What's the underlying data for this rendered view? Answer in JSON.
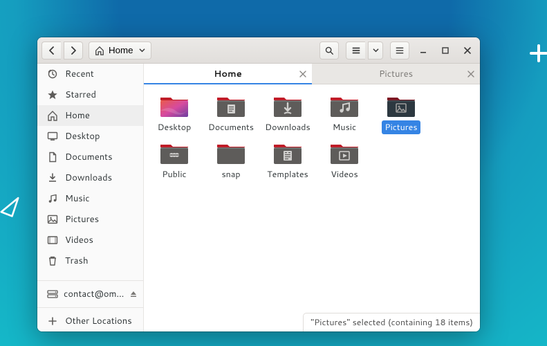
{
  "header": {
    "path_label": "Home"
  },
  "sidebar": {
    "items": [
      {
        "key": "recent",
        "label": "Recent",
        "icon": "clock"
      },
      {
        "key": "starred",
        "label": "Starred",
        "icon": "star"
      },
      {
        "key": "home",
        "label": "Home",
        "icon": "home",
        "selected": true
      },
      {
        "key": "desktop",
        "label": "Desktop",
        "icon": "desktop"
      },
      {
        "key": "documents",
        "label": "Documents",
        "icon": "documents"
      },
      {
        "key": "downloads",
        "label": "Downloads",
        "icon": "download"
      },
      {
        "key": "music",
        "label": "Music",
        "icon": "music"
      },
      {
        "key": "pictures",
        "label": "Pictures",
        "icon": "pictures"
      },
      {
        "key": "videos",
        "label": "Videos",
        "icon": "videos"
      },
      {
        "key": "trash",
        "label": "Trash",
        "icon": "trash"
      }
    ],
    "account_label": "contact@om…",
    "other_locations_label": "Other Locations"
  },
  "tabs": [
    {
      "label": "Home",
      "active": true
    },
    {
      "label": "Pictures",
      "active": false
    }
  ],
  "folders": [
    {
      "label": "Desktop",
      "variant": "desktop"
    },
    {
      "label": "Documents",
      "variant": "documents"
    },
    {
      "label": "Downloads",
      "variant": "downloads"
    },
    {
      "label": "Music",
      "variant": "music"
    },
    {
      "label": "Pictures",
      "variant": "pictures",
      "selected": true
    },
    {
      "label": "Public",
      "variant": "public"
    },
    {
      "label": "snap",
      "variant": "plain"
    },
    {
      "label": "Templates",
      "variant": "templates"
    },
    {
      "label": "Videos",
      "variant": "videos"
    }
  ],
  "status": {
    "text": "\"Pictures\" selected  (containing 18 items)"
  }
}
